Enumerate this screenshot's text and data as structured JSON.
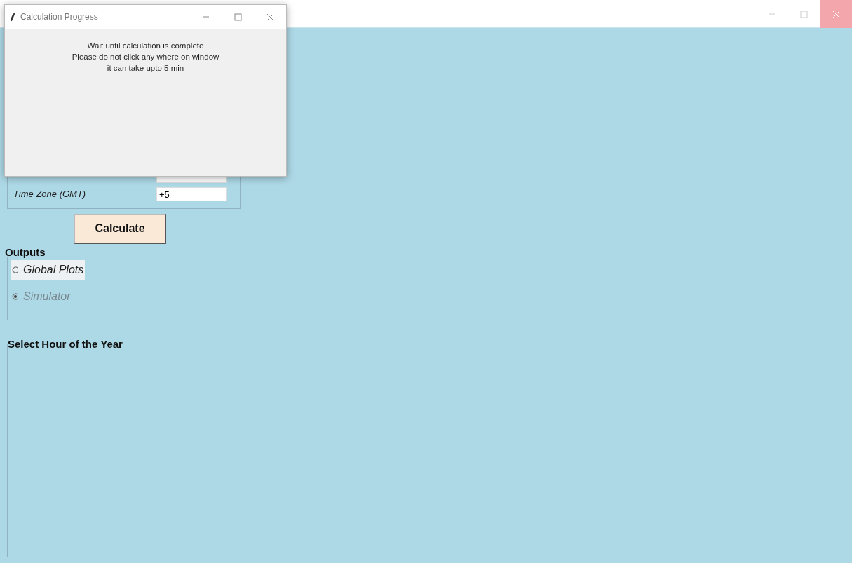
{
  "inputs": [
    {
      "label": "Time Zone (GMT)",
      "value": "+5"
    }
  ],
  "calculate_button": "Calculate",
  "outputs": {
    "title": "Outputs",
    "options": [
      {
        "label": "Global Plots",
        "selected": false,
        "disabled": false,
        "highlighted": true
      },
      {
        "label": "Simulator",
        "selected": true,
        "disabled": true,
        "highlighted": false
      }
    ]
  },
  "hour_panel": {
    "title": "Select Hour of the Year"
  },
  "dialog": {
    "title": "Calculation Progress",
    "lines": [
      "Wait until calculation is complete",
      "Please do not click any where on window",
      "it can take upto 5 min"
    ]
  }
}
